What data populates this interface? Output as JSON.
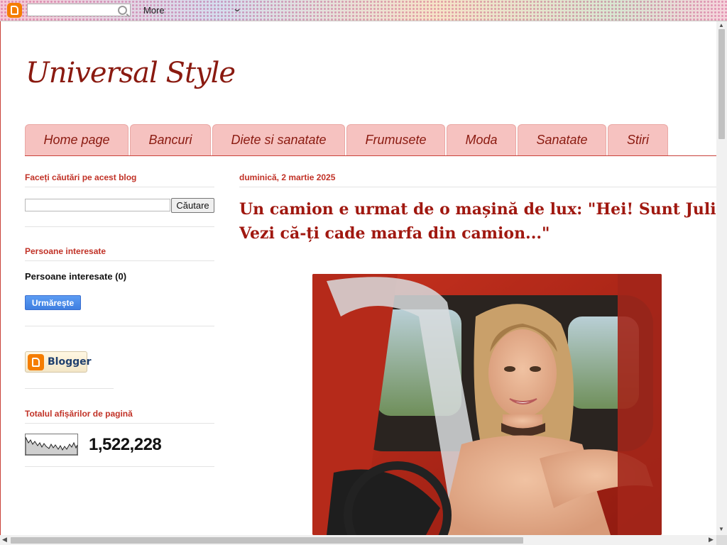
{
  "navbar": {
    "more_label": "More",
    "logo_icon": "blogger-icon",
    "search_icon": "search-icon"
  },
  "blog": {
    "title": "Universal Style"
  },
  "tabs": [
    {
      "label": "Home page"
    },
    {
      "label": "Bancuri"
    },
    {
      "label": "Diete si sanatate"
    },
    {
      "label": "Frumusete"
    },
    {
      "label": "Moda"
    },
    {
      "label": "Sanatate"
    },
    {
      "label": "Stiri"
    }
  ],
  "sidebar": {
    "search": {
      "title": "Faceți căutări pe acest blog",
      "button_label": "Căutare",
      "value": ""
    },
    "followers": {
      "title": "Persoane interesate",
      "count_label": "Persoane interesate (0)",
      "follow_label": "Urmărește"
    },
    "badge": {
      "label": "Blogger"
    },
    "stats": {
      "title": "Totalul afișărilor de pagină",
      "count": "1,522,228"
    }
  },
  "post": {
    "date": "duminică, 2 martie 2025",
    "title": "Un camion e urmat de o mașină de lux: \"Hei! Sunt Julie! Vezi că-ți cade marfa din camion...\""
  },
  "colors": {
    "accent": "#c13227",
    "title": "#8a1a10",
    "tab_bg": "#f6c2c0"
  }
}
